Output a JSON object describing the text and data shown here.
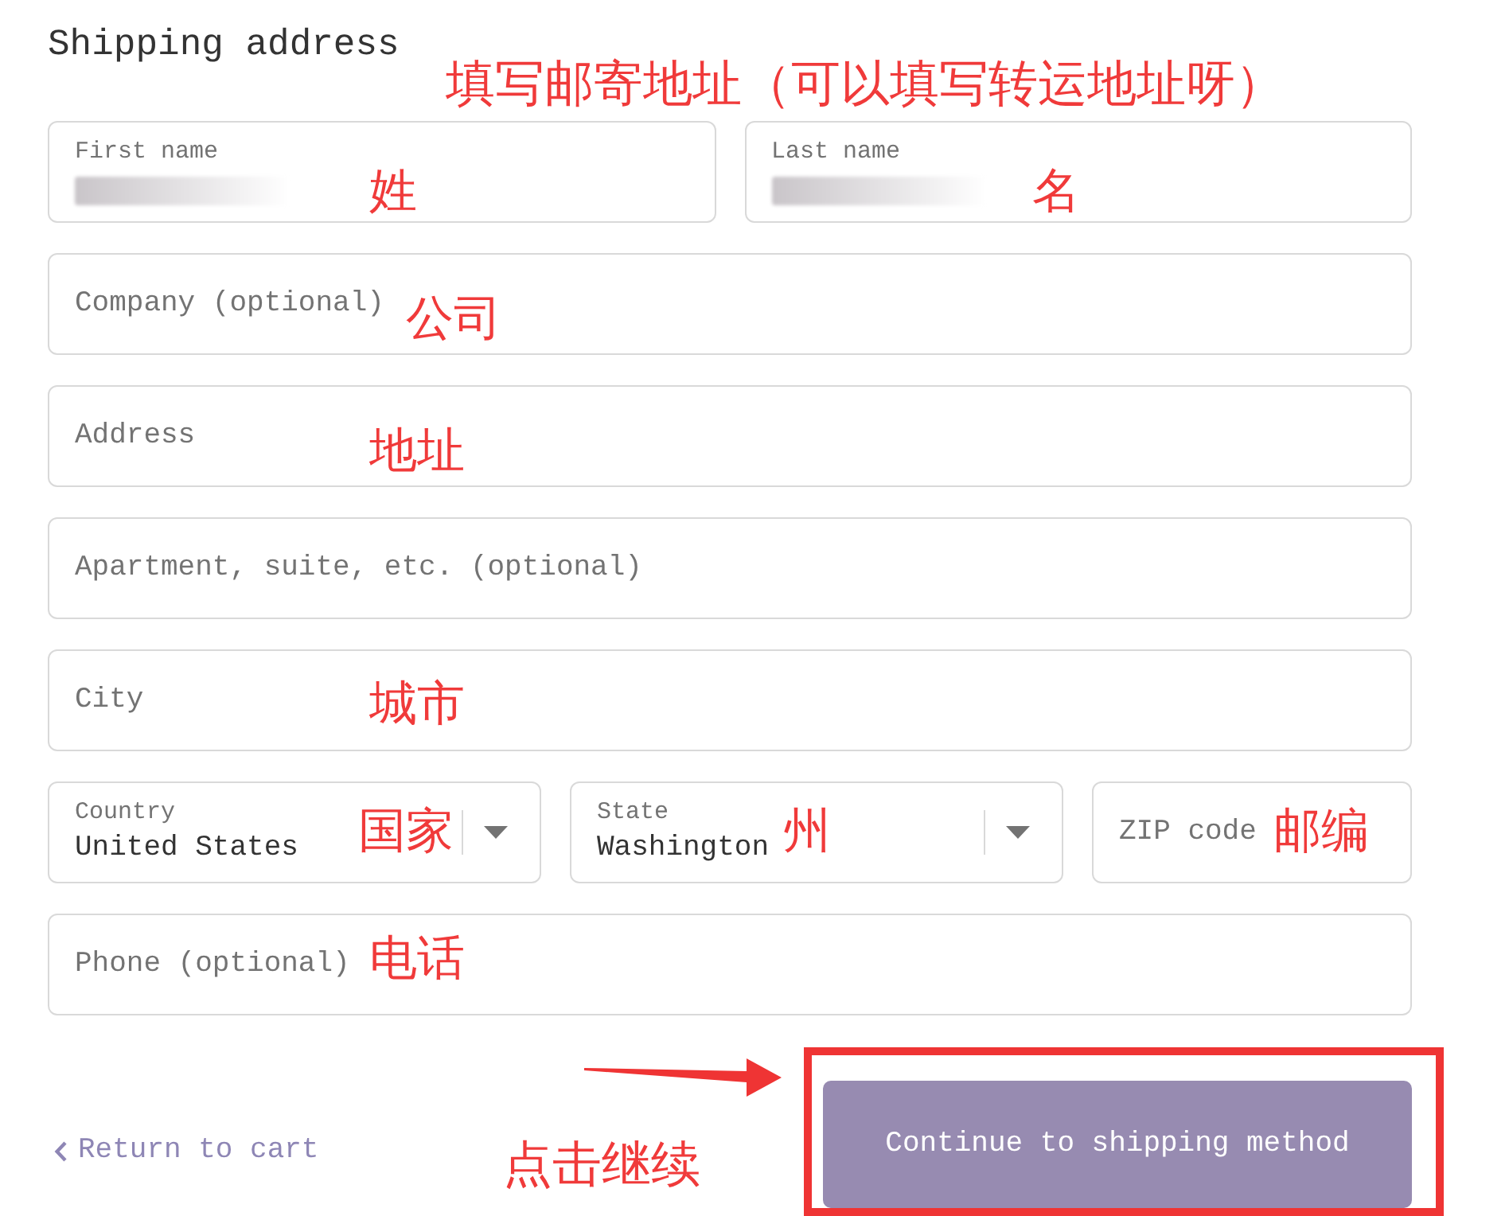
{
  "heading": "Shipping address",
  "heading_note": "填写邮寄地址（可以填写转运地址呀）",
  "rows": [
    [
      {
        "kind": "text",
        "label": "First name",
        "redacted": true,
        "note": "姓"
      },
      {
        "kind": "text",
        "label": "Last name",
        "redacted": true,
        "note": "名"
      }
    ],
    [
      {
        "kind": "text",
        "placeholder": "Company (optional)",
        "redacted": false,
        "note": "公司"
      }
    ],
    [
      {
        "kind": "text",
        "placeholder": "Address",
        "redacted": false,
        "note": "地址"
      }
    ],
    [
      {
        "kind": "text",
        "placeholder": "Apartment, suite, etc. (optional)",
        "redacted": false
      }
    ],
    [
      {
        "kind": "text",
        "placeholder": "City",
        "redacted": false,
        "note": "城市"
      }
    ],
    [
      {
        "kind": "select",
        "label": "Country",
        "value": "United States",
        "note": "国家"
      },
      {
        "kind": "select",
        "label": "State",
        "value": "Washington",
        "note": "州"
      },
      {
        "kind": "text",
        "placeholder": "ZIP code",
        "redacted": false,
        "note": "邮编"
      }
    ],
    [
      {
        "kind": "text",
        "placeholder": "Phone (optional)",
        "redacted": false,
        "note": "电话"
      }
    ]
  ],
  "return_link": {
    "label": "Return to cart"
  },
  "continue_button": {
    "label": "Continue to shipping method",
    "highlighted": true
  },
  "button_note": "点击继续"
}
